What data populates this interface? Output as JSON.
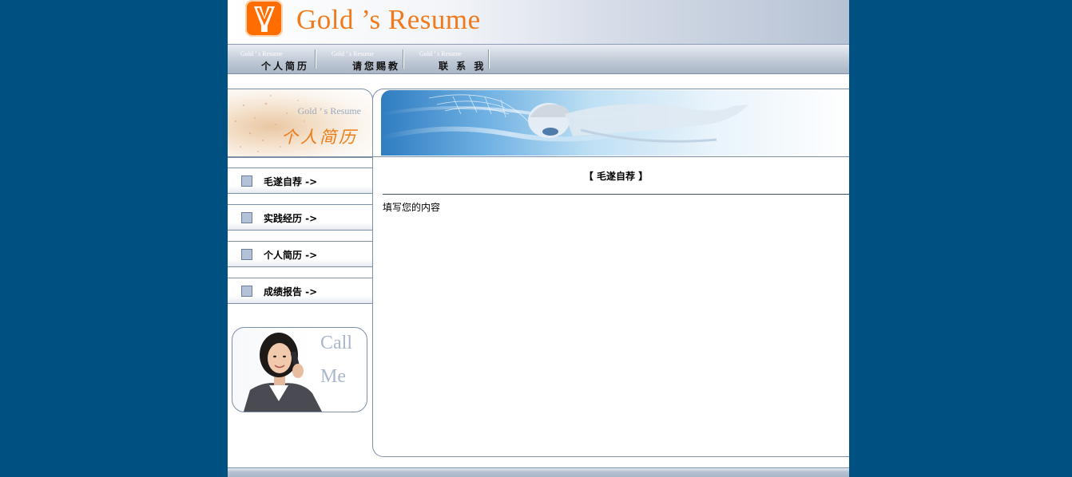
{
  "header": {
    "brand": "Gold ’s Resume"
  },
  "nav": {
    "items": [
      {
        "en": "Gold ’ s Resume",
        "cn": "个人简历"
      },
      {
        "en": "Gold ’ s Resume",
        "cn": "请您赐教"
      },
      {
        "en": "Gold ’ s Resume",
        "cn": "联 系 我"
      }
    ]
  },
  "sidebar": {
    "banner_en": "Gold ’ s Resume",
    "banner_cn": "个人简历",
    "items": [
      {
        "label": "毛遂自荐 ->"
      },
      {
        "label": "实践经历 ->"
      },
      {
        "label": "个人简历 ->"
      },
      {
        "label": "成绩报告 ->"
      }
    ],
    "callme": {
      "line1": "Call",
      "line2": "Me"
    }
  },
  "main": {
    "section_title": "【 毛遂自荐 】",
    "content": "填写您的内容"
  },
  "colors": {
    "background": "#005082",
    "brand": "#f07a1c",
    "logo": "#ff6d00",
    "border": "#7d8ea7"
  },
  "icons": {
    "logo": "v-logo-icon",
    "menu_bullet": "square-bullet-icon"
  }
}
